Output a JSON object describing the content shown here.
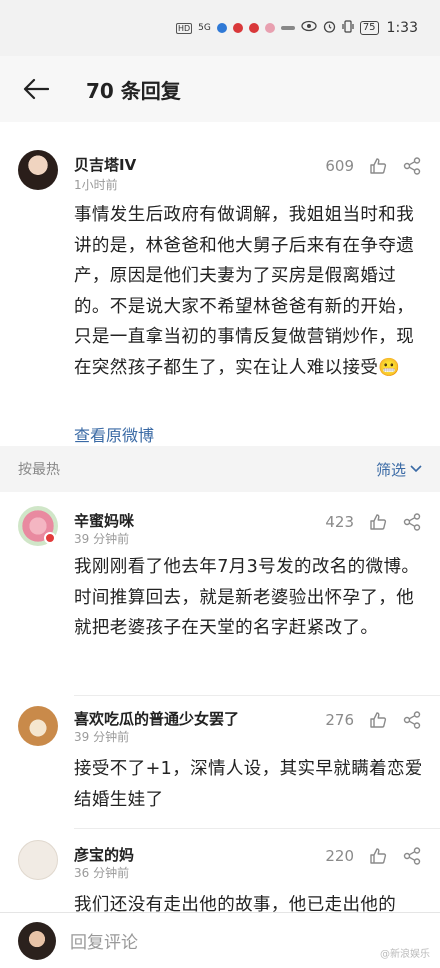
{
  "status_bar": {
    "battery": "75",
    "time": "1:33",
    "network": "5G"
  },
  "nav": {
    "title": "70 条回复"
  },
  "main_post": {
    "author": "贝吉塔IV",
    "time": "1小时前",
    "likes": "609",
    "body": "事情发生后政府有做调解，我姐姐当时和我讲的是，林爸爸和他大舅子后来有在争夺遗产，原因是他们夫妻为了买房是假离婚过的。不是说大家不希望林爸爸有新的开始，只是一直拿当初的事情反复做营销炒作，现在突然孩子都生了，实在让人难以接受😬",
    "link": "查看原微博"
  },
  "sort_bar": {
    "label": "按最热",
    "filter": "筛选"
  },
  "comments": [
    {
      "author": "辛蜜妈咪",
      "time": "39 分钟前",
      "likes": "423",
      "body": "我刚刚看了他去年7月3号发的改名的微博。时间推算回去，就是新老婆验出怀孕了，他就把老婆孩子在天堂的名字赶紧改了。"
    },
    {
      "author": "喜欢吃瓜的普通少女罢了",
      "time": "39 分钟前",
      "likes": "276",
      "body": "接受不了+1，深情人设，其实早就瞒着恋爱结婚生娃了"
    },
    {
      "author": "彦宝的妈",
      "time": "36 分钟前",
      "likes": "220",
      "body": "我们还没有走出他的故事，他已走出他的"
    }
  ],
  "bottom_bar": {
    "placeholder": "回复评论",
    "watermark": "@新浪娱乐"
  }
}
